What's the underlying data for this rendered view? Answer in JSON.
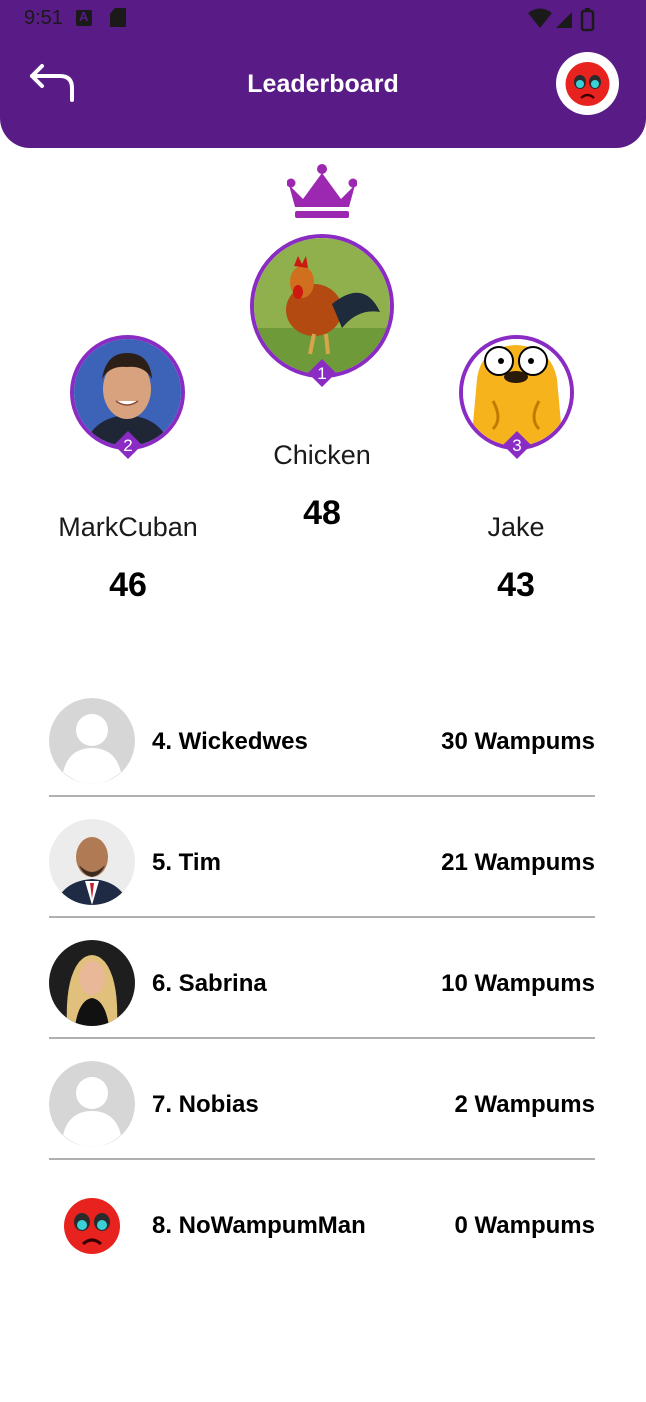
{
  "status_bar": {
    "time": "9:51"
  },
  "header": {
    "title": "Leaderboard"
  },
  "podium": [
    {
      "rank": "1",
      "name": "Chicken",
      "score": "48"
    },
    {
      "rank": "2",
      "name": "MarkCuban",
      "score": "46"
    },
    {
      "rank": "3",
      "name": "Jake",
      "score": "43"
    }
  ],
  "list": [
    {
      "label": "4. Wickedwes",
      "score": "30 Wampums",
      "avatar": "default-avatar"
    },
    {
      "label": "5. Tim",
      "score": "21 Wampums",
      "avatar": "photo"
    },
    {
      "label": "6. Sabrina",
      "score": "10 Wampums",
      "avatar": "photo"
    },
    {
      "label": "7. Nobias",
      "score": "2 Wampums",
      "avatar": "default-avatar"
    },
    {
      "label": "8. NoWampumMan",
      "score": "0 Wampums",
      "avatar": "sad-emoji"
    }
  ],
  "colors": {
    "header": "#591c87",
    "accent": "#8a2cc4",
    "crown": "#9c27b0"
  }
}
